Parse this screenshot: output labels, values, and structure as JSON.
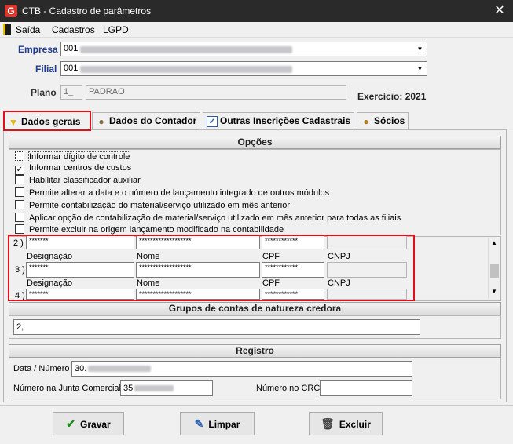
{
  "window": {
    "title": "CTB - Cadastro de parâmetros",
    "icon_letter": "G",
    "close_glyph": "✕"
  },
  "menu": {
    "items": [
      "Saída",
      "Cadastros",
      "LGPD"
    ]
  },
  "header": {
    "empresa_label": "Empresa",
    "empresa_value": "001",
    "filial_label": "Filial",
    "filial_value": "001",
    "plano_label": "Plano",
    "plano_code": "1_",
    "plano_name": "PADRAO",
    "exercicio": "Exercício: 2021"
  },
  "tabs": [
    {
      "label": "Dados gerais",
      "icon": "funnel-icon"
    },
    {
      "label": "Dados do Contador",
      "icon": "person-icon"
    },
    {
      "label": "Outras Inscrições Cadastrais",
      "icon": "checkbox-icon"
    },
    {
      "label": "Sócios",
      "icon": "people-icon"
    }
  ],
  "opcoes": {
    "title": "Opções",
    "items": [
      {
        "label": "Informar dígito de controle",
        "checked": false
      },
      {
        "label": "Informar centros de custos",
        "checked": true
      },
      {
        "label": "Habilitar classificador auxiliar",
        "checked": false
      },
      {
        "label": "Permite alterar a data e o número de lançamento integrado de outros módulos",
        "checked": false
      },
      {
        "label": "Permite contabilização do material/serviço utilizado em mês anterior",
        "checked": false
      },
      {
        "label": "Aplicar opção de contabilização de material/serviço utilizado em mês anterior para todas as filiais",
        "checked": false
      },
      {
        "label": "Permite excluir na origem lançamento modificado na contabilidade",
        "checked": false
      }
    ]
  },
  "socios_grid": {
    "col_labels": [
      "Designação",
      "Nome",
      "CPF",
      "CNPJ"
    ],
    "rows": [
      {
        "num": "2 )",
        "designacao": "*******",
        "nome": "*******************",
        "cpf": "************"
      },
      {
        "num": "3 )",
        "designacao": "*******",
        "nome": "*******************",
        "cpf": "************"
      },
      {
        "num": "4 )",
        "designacao": "*******",
        "nome": "*******************",
        "cpf": "************"
      }
    ]
  },
  "grupos": {
    "title": "Grupos de contas de natureza credora",
    "value": "2,"
  },
  "registro": {
    "title": "Registro",
    "data_numero_label": "Data / Número",
    "data_numero_value": "30.",
    "junta_label": "Número na Junta Comercial",
    "junta_value": "35",
    "crc_label": "Número no CRC",
    "crc_value": ""
  },
  "buttons": {
    "gravar": "Gravar",
    "limpar": "Limpar",
    "excluir": "Excluir"
  },
  "colors": {
    "accent_label": "#1f3a8f",
    "highlight": "#e0101a",
    "titlebar": "#2a2a2a"
  }
}
